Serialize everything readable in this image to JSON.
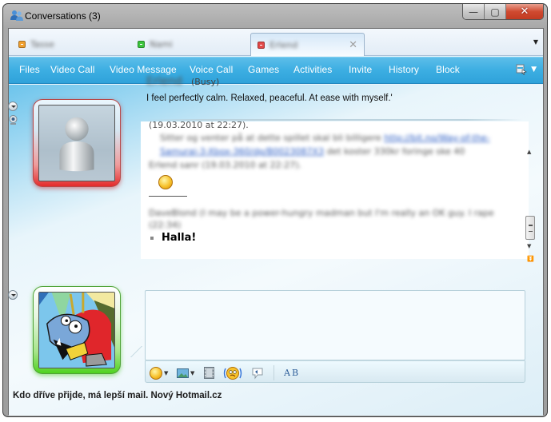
{
  "window": {
    "title": "Conversations (3)",
    "icons": {
      "app": "msn-buddies-icon",
      "minimize": "minimize-icon",
      "maximize": "maximize-icon",
      "close": "close-icon"
    },
    "glyphs": {
      "minimize": "—",
      "maximize": "▢",
      "close": "✕"
    }
  },
  "tabs": [
    {
      "name": "Tasse",
      "status": "away",
      "status_color": "#f0a030",
      "active": false
    },
    {
      "name": "Nami",
      "status": "online",
      "status_color": "#3cc43c",
      "active": false
    },
    {
      "name": "Erlend",
      "status": "busy",
      "status_color": "#e24848",
      "active": true
    }
  ],
  "tab_close_glyph": "✕",
  "tab_overflow_glyph": "▼",
  "menu": {
    "items": [
      "Files",
      "Video Call",
      "Video Message",
      "Voice Call",
      "Games",
      "Activities",
      "Invite",
      "History",
      "Block"
    ],
    "options_icon": "window-options-icon",
    "options_glyph": "▼"
  },
  "contact": {
    "name": "Erlend",
    "status": "(Busy)",
    "personal_message": "I feel perfectly calm. Relaxed, peaceful. At ease with myself.'",
    "status_color": "#e42b2b"
  },
  "history": {
    "lines": [
      {
        "text": "(19.03.2010 at 22:27)."
      },
      {
        "text": "Sitter og venter på at dette spillet skal bli billigere ",
        "link": "http://bit.no/Way-of-the-"
      },
      {
        "link": "Samurai-3-Xbox-360/dp/B0023087X3",
        "text": " det koster 330kr foringe ske 40"
      },
      {
        "text": "Erlend sanr (19.03.2010 at 22:27)."
      },
      {
        "text": "DaveBlond (I may be a power-hungry madman but I'm really an OK guy. I rape"
      },
      {
        "text": "(22:34)"
      }
    ],
    "last_message": "Halla!"
  },
  "own": {
    "status_color": "#4fd21f"
  },
  "compose": {
    "value": "",
    "toolbar": [
      "emoticon-icon",
      "wink-background-icon",
      "video-clip-icon",
      "nudge-icon",
      "voice-clip-icon",
      "font-icon"
    ],
    "font_label": "AB"
  },
  "ad": {
    "text": "Kdo dříve přijde, má lepší mail. Nový Hotmail.cz"
  }
}
